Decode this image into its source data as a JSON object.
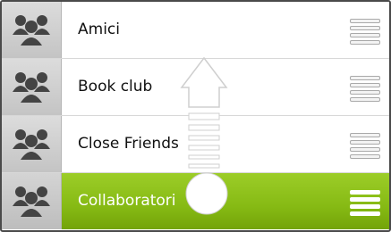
{
  "list": {
    "groups": [
      {
        "name": "Amici",
        "icon": "group-photo-icon"
      },
      {
        "name": "Book club",
        "icon": "group-photo-icon"
      },
      {
        "name": "Close Friends",
        "icon": "group-photo-icon"
      },
      {
        "name": "Collaboratori",
        "icon": "group-photo-icon",
        "selected": true
      }
    ],
    "drag_handle_icon": "drag-handle-icon",
    "selected_color": "#86ba14"
  },
  "gesture": {
    "icons": [
      "swipe-up-arrow-icon",
      "touch-point-icon"
    ]
  }
}
